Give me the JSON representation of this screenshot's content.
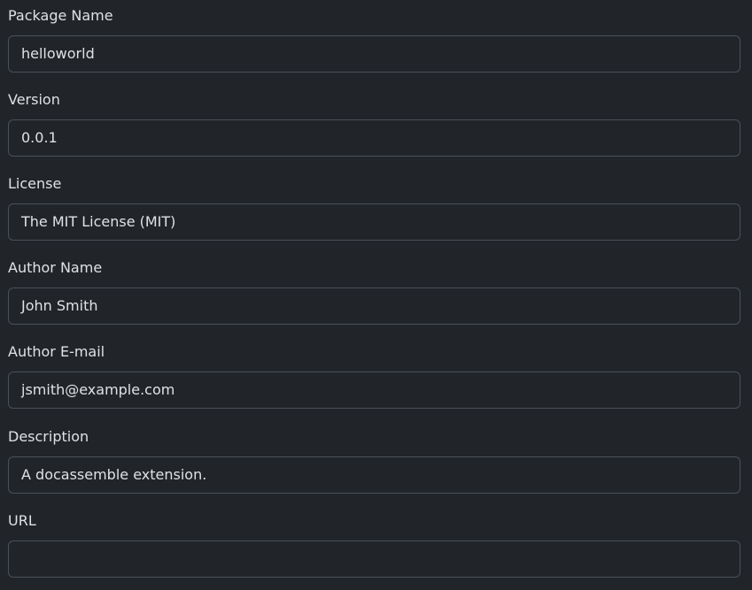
{
  "form": {
    "fields": [
      {
        "label": "Package Name",
        "value": "helloworld"
      },
      {
        "label": "Version",
        "value": "0.0.1"
      },
      {
        "label": "License",
        "value": "The MIT License (MIT)"
      },
      {
        "label": "Author Name",
        "value": "John Smith"
      },
      {
        "label": "Author E-mail",
        "value": "jsmith@example.com"
      },
      {
        "label": "Description",
        "value": "A docassemble extension."
      },
      {
        "label": "URL",
        "value": ""
      }
    ]
  }
}
